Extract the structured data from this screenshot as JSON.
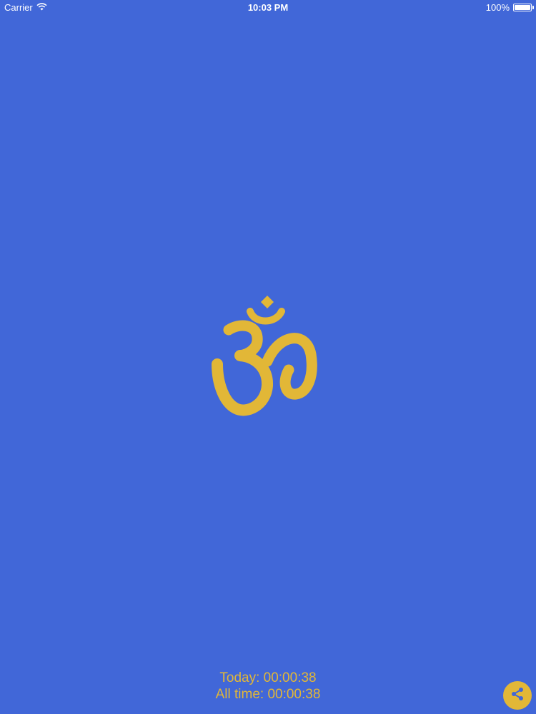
{
  "status_bar": {
    "carrier": "Carrier",
    "time": "10:03 PM",
    "battery": "100%",
    "battery_level": 1.0,
    "signal_icon": "wifi-icon",
    "battery_icon": "battery-icon"
  },
  "main": {
    "symbol_icon": "om-icon",
    "symbol_color": "#E2B737",
    "background_color": "#4167D8"
  },
  "timers": {
    "today": "Today: 00:00:38",
    "all_time": "All time: 00:00:38"
  },
  "share": {
    "icon": "share-icon",
    "color": "#E2B737"
  }
}
